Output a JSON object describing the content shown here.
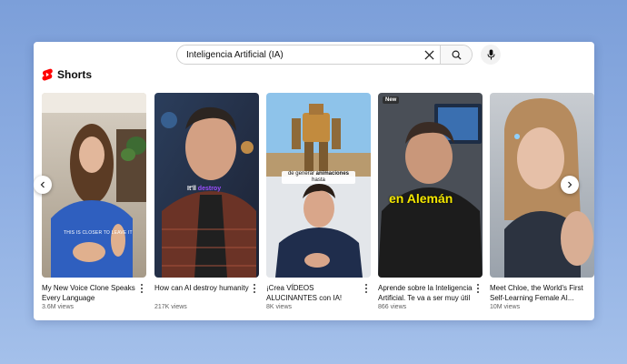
{
  "search": {
    "value": "Inteligencia Artificial (IA)"
  },
  "section": {
    "title": "Shorts"
  },
  "cards": [
    {
      "title": "My New Voice Clone Speaks Every Language",
      "views": "3.6M views",
      "overlay": "THIS IS CLOSER TO LEAVE IT"
    },
    {
      "title": "How can AI destroy humanity",
      "views": "217K views",
      "overlay_a": "It'll",
      "overlay_b": "destroy"
    },
    {
      "title": "¡Crea VÍDEOS ALUCINANTES con IA! #inteligenciaartificial",
      "views": "8K views",
      "overlay_a": "de generar",
      "overlay_b": "animaciones",
      "overlay_c": "hasta"
    },
    {
      "title": "Aprende sobre la Inteligencia Artificial. Te va a ser muy útil",
      "views": "866 views",
      "badge": "New",
      "overlay": "en Alemán"
    },
    {
      "title": "Meet Chloe, the World's First Self-Learning Female AI...",
      "views": "10M views"
    }
  ]
}
